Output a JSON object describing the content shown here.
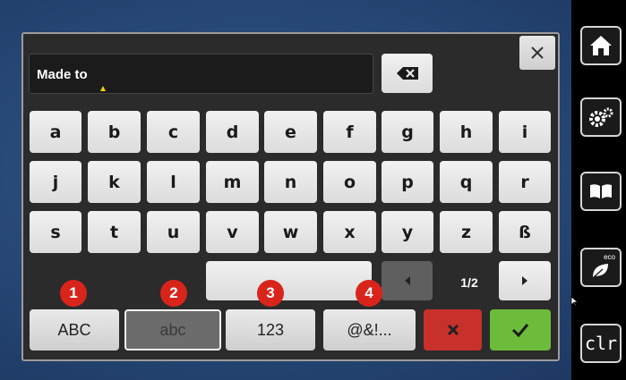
{
  "input": {
    "text": "Made to"
  },
  "keyboard": {
    "rows": [
      [
        "a",
        "b",
        "c",
        "d",
        "e",
        "f",
        "g",
        "h",
        "i"
      ],
      [
        "j",
        "k",
        "l",
        "m",
        "n",
        "o",
        "p",
        "q",
        "r"
      ],
      [
        "s",
        "t",
        "u",
        "v",
        "w",
        "x",
        "y",
        "z",
        "ß"
      ]
    ],
    "page_indicator": "1/2"
  },
  "modes": [
    {
      "label": "ABC",
      "badge": "1"
    },
    {
      "label": "abc",
      "badge": "2",
      "selected": true
    },
    {
      "label": "123",
      "badge": "3"
    },
    {
      "label": "@&!...",
      "badge": "4"
    }
  ],
  "sidebar": {
    "clear_label": "clr",
    "eco_label": "eco"
  },
  "icons": {
    "backspace": "backspace-icon",
    "close": "close-icon",
    "prev": "arrow-left-icon",
    "next": "arrow-right-icon",
    "cancel": "x-icon",
    "confirm": "check-icon",
    "home": "home-icon",
    "settings": "gears-icon",
    "help": "book-icon",
    "eco": "leaf-icon"
  },
  "colors": {
    "cancel": "#c8302b",
    "confirm": "#6dbb3a",
    "badge": "#d9241b",
    "cursor": "#f5d000"
  }
}
